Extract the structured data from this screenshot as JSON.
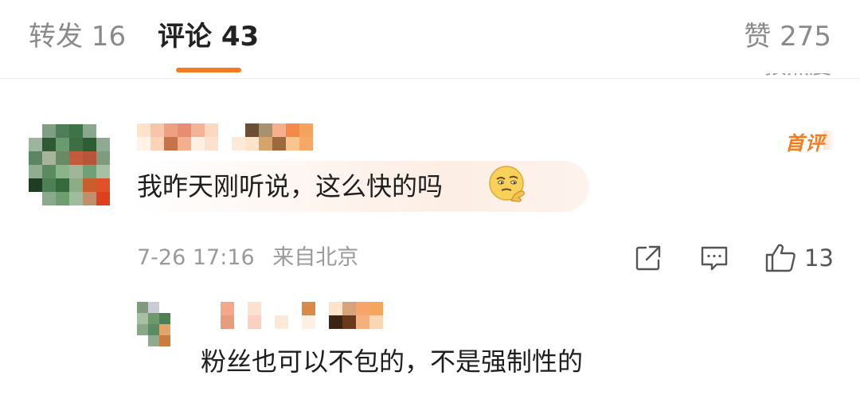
{
  "tabs": {
    "repost": "转发 16",
    "comments": "评论 43",
    "likes": "赞 275"
  },
  "cut_off_text": "按热度",
  "comment": {
    "first_badge": "首评",
    "text": "我昨天刚听说，这么快的吗",
    "emoji_icon": "thinking-face-emoji",
    "time": "7-26 17:16",
    "location": "来自北京",
    "like_count": "13"
  },
  "reply": {
    "text": "粉丝也可以不包的，不是强制性的"
  },
  "colors": {
    "accent": "#f47b20",
    "secondary_text": "#9a9a9a",
    "primary_text": "#1e1e1e"
  }
}
